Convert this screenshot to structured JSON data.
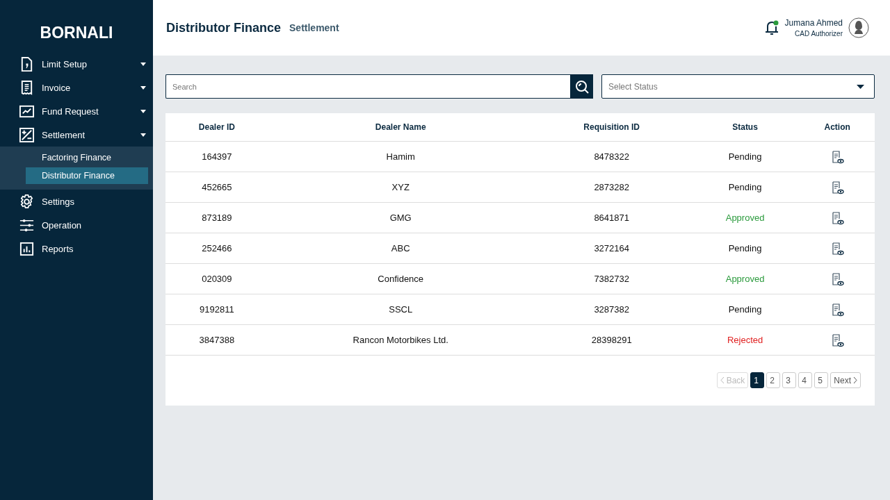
{
  "sidebar": {
    "logo": "BORNALI",
    "items": [
      {
        "label": "Limit Setup",
        "kind": "menu"
      },
      {
        "label": "Invoice",
        "kind": "menu"
      },
      {
        "label": "Fund Request",
        "kind": "menu"
      },
      {
        "label": "Settlement",
        "kind": "menu",
        "children": [
          {
            "label": "Factoring Finance",
            "selected": false
          },
          {
            "label": "Distributor Finance",
            "selected": true
          }
        ]
      },
      {
        "label": "Settings",
        "kind": "link"
      },
      {
        "label": "Operation",
        "kind": "link"
      },
      {
        "label": "Reports",
        "kind": "link"
      }
    ]
  },
  "header": {
    "title": "Distributor Finance",
    "subtitle": "Settlement",
    "user": {
      "name": "Jumana Ahmed",
      "role": "CAD Authorizer"
    }
  },
  "search": {
    "placeholder": "Search"
  },
  "status_select": {
    "placeholder": "Select Status"
  },
  "table": {
    "columns": [
      "Dealer ID",
      "Dealer Name",
      "Requisition ID",
      "Status",
      "Action"
    ],
    "rows": [
      {
        "dealer_id": "164397",
        "dealer_name": "Hamim",
        "requisition_id": "8478322",
        "status": "Pending",
        "kind": "pending"
      },
      {
        "dealer_id": "452665",
        "dealer_name": "XYZ",
        "requisition_id": "2873282",
        "status": "Pending",
        "kind": "pending"
      },
      {
        "dealer_id": "873189",
        "dealer_name": "GMG",
        "requisition_id": "8641871",
        "status": "Approved",
        "kind": "approved"
      },
      {
        "dealer_id": "252466",
        "dealer_name": "ABC",
        "requisition_id": "3272164",
        "status": "Pending",
        "kind": "pending"
      },
      {
        "dealer_id": "020309",
        "dealer_name": "Confidence",
        "requisition_id": "7382732",
        "status": "Approved",
        "kind": "approved"
      },
      {
        "dealer_id": "9192811",
        "dealer_name": "SSCL",
        "requisition_id": "3287382",
        "status": "Pending",
        "kind": "pending"
      },
      {
        "dealer_id": "3847388",
        "dealer_name": "Rancon Motorbikes Ltd.",
        "requisition_id": "28398291",
        "status": "Rejected",
        "kind": "rejected"
      }
    ]
  },
  "pagination": {
    "back": {
      "label": "Back",
      "disabled": true
    },
    "pages": [
      {
        "label": "1",
        "selected": true
      },
      {
        "label": "2",
        "selected": false
      },
      {
        "label": "3",
        "selected": false
      },
      {
        "label": "4",
        "selected": false
      },
      {
        "label": "5",
        "selected": false
      }
    ],
    "next": {
      "label": "Next",
      "disabled": false
    }
  }
}
